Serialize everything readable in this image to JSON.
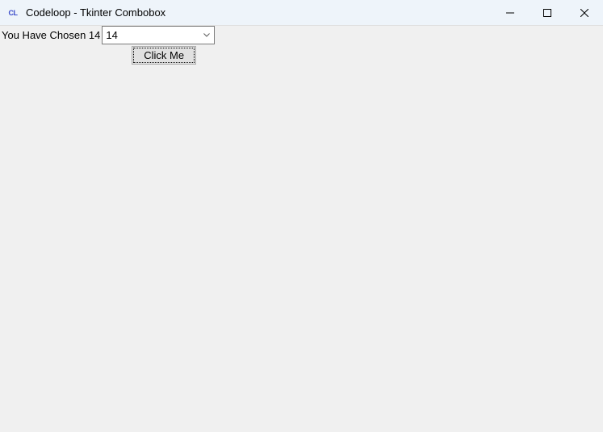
{
  "titlebar": {
    "icon_text": "CL",
    "title": "Codeloop - Tkinter Combobox"
  },
  "content": {
    "label_text": "You Have Chosen 14",
    "combo_value": "14",
    "button_label": "Click Me"
  }
}
